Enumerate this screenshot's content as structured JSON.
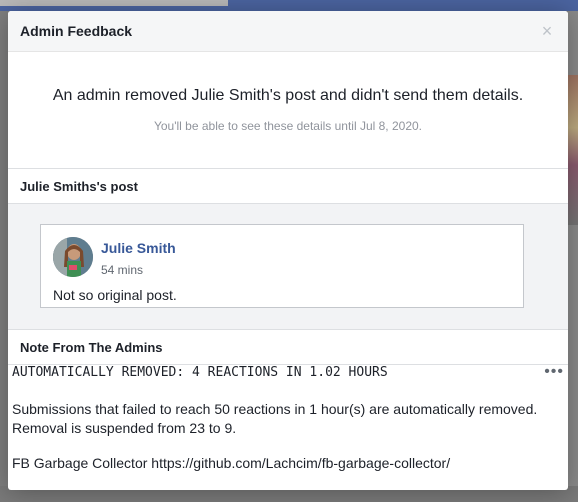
{
  "modal": {
    "title": "Admin Feedback",
    "close_glyph": "×"
  },
  "summary": {
    "main_text": "An admin removed Julie Smith's post and didn't send them details.",
    "sub_text": "You'll be able to see these details until Jul 8, 2020."
  },
  "post_section": {
    "header": "Julie Smiths's post",
    "author": "Julie Smith",
    "time": "54 mins",
    "text": "Not so original post."
  },
  "notes_section": {
    "header": "Note From The Admins",
    "note_title": "AUTOMATICALLY REMOVED: 4 REACTIONS IN 1.02 HOURS",
    "more_glyph": "•••",
    "body_line_1": "Submissions that failed to reach 50 reactions in 1 hour(s) are automatically removed.",
    "body_line_2": "Removal is suspended from 23 to 9.",
    "footer": "FB Garbage Collector https://github.com/Lachcim/fb-garbage-collector/"
  },
  "colors": {
    "link_blue": "#385898",
    "header_bg": "#f5f6f7",
    "post_area_bg": "#f2f3f5"
  }
}
